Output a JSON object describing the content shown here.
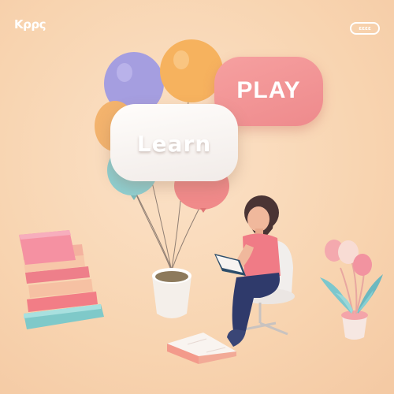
{
  "brand": {
    "logo_text": "Kρρς",
    "badge_text": "ɛɛɛɛ"
  },
  "bubbles": {
    "play": "PLAY",
    "learn": "Learn"
  },
  "colors": {
    "background": "#f8d6b4",
    "balloon_purple": "#a59ee0",
    "balloon_orange": "#f6b25e",
    "balloon_teal": "#8ecfd0",
    "balloon_pink": "#f08a8a",
    "play_bubble": "#f29596",
    "shirt": "#f07b86",
    "pants": "#2f3a6b"
  }
}
